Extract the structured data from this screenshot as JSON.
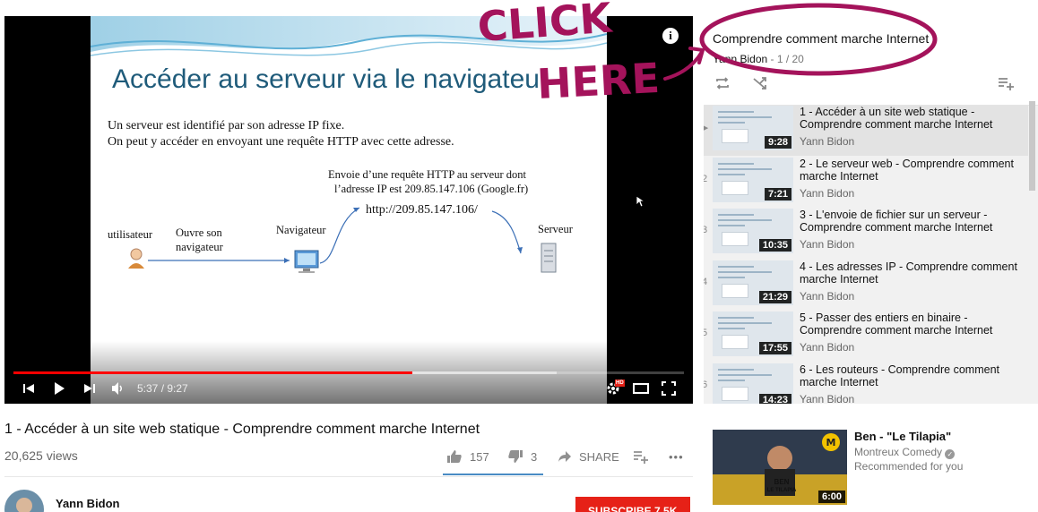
{
  "player": {
    "slide_title": "Accéder au serveur via le navigateur",
    "slide_line1": "Un serveur est identifié par son adresse IP fixe.",
    "slide_line2": "On peut y accéder en envoyant une requête HTTP avec cette adresse.",
    "diagram_note_line1": "Envoie d’une requête HTTP au serveur dont",
    "diagram_note_line2": "l’adresse IP est 209.85.147.106 (Google.fr)",
    "diagram_url": "http://209.85.147.106/",
    "diagram_user": "utilisateur",
    "diagram_open_line1": "Ouvre son",
    "diagram_open_line2": "navigateur",
    "diagram_browser": "Navigateur",
    "diagram_server": "Serveur",
    "time_display": "5:37 / 9:27",
    "progress_played": 0.595,
    "progress_loaded": 0.81,
    "hd_badge": "HD"
  },
  "annotation": {
    "line1": "CLICK",
    "line2": "HERE",
    "arrow": "→",
    "color": "#a4135b"
  },
  "playlist": {
    "title": "Comprendre comment marche Internet",
    "author": "Yann Bidon",
    "position": " - 1 / 20",
    "items": [
      {
        "index": "▶",
        "title": "1 - Accéder à un site web statique - Comprendre comment marche Internet",
        "author": "Yann Bidon",
        "duration": "9:28"
      },
      {
        "index": "2",
        "title": "2 - Le serveur web - Comprendre comment marche Internet",
        "author": "Yann Bidon",
        "duration": "7:21"
      },
      {
        "index": "3",
        "title": "3 - L'envoie de fichier sur un serveur - Comprendre comment marche Internet",
        "author": "Yann Bidon",
        "duration": "10:35"
      },
      {
        "index": "4",
        "title": "4 - Les adresses IP - Comprendre comment marche Internet",
        "author": "Yann Bidon",
        "duration": "21:29"
      },
      {
        "index": "5",
        "title": "5 - Passer des entiers en binaire - Comprendre comment marche Internet",
        "author": "Yann Bidon",
        "duration": "17:55"
      },
      {
        "index": "6",
        "title": "6 - Les routeurs - Comprendre comment marche Internet",
        "author": "Yann Bidon",
        "duration": "14:23"
      }
    ]
  },
  "video": {
    "title": "1 - Accéder à un site web statique - Comprendre comment marche Internet",
    "views": "20,625 views",
    "likes": "157",
    "dislikes": "3",
    "share_label": "SHARE",
    "more_label": "•••"
  },
  "channel": {
    "name": "Yann Bidon",
    "subscribe_label": "SUBSCRIBE  7.5K"
  },
  "recommended": {
    "title": "Ben - \"Le Tilapia\"",
    "channel": "Montreux Comedy",
    "note": "Recommended for you",
    "duration": "6:00",
    "thumb_caption_line1": "BEN",
    "thumb_caption_line2": "LE TILAPIA"
  }
}
